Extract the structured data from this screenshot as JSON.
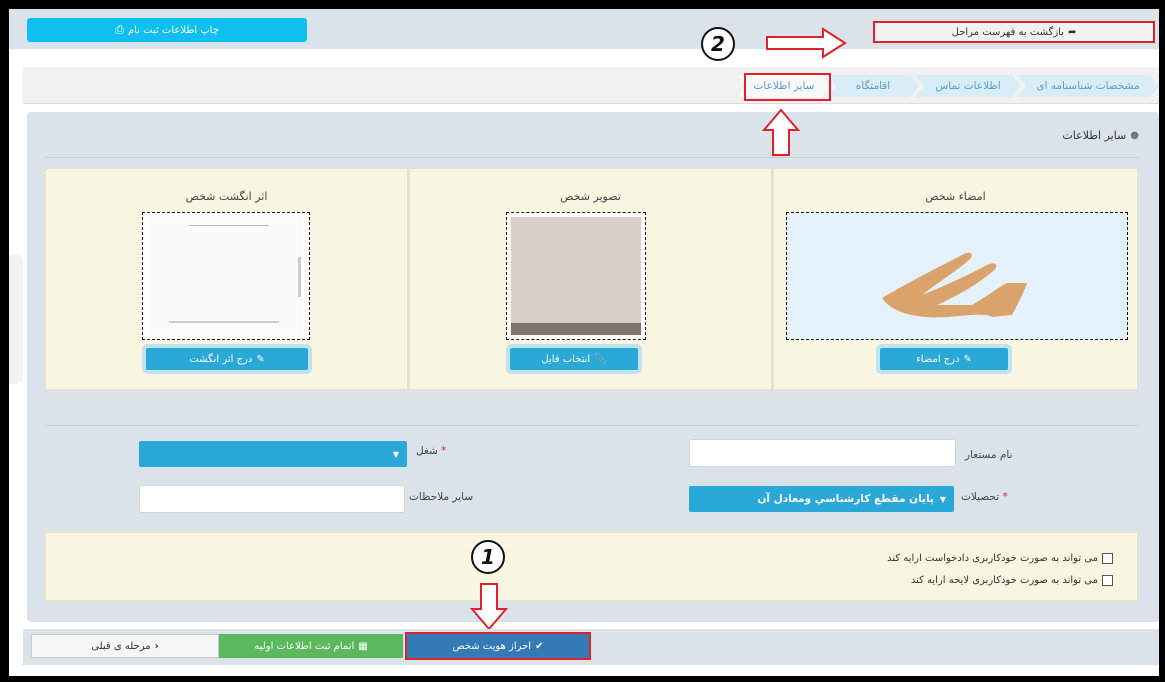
{
  "topbar": {
    "print_label": "چاپ اطلاعات ثبت نام",
    "back_label": "بازگشت به فهرست مراحل"
  },
  "breadcrumb": {
    "items": [
      "مشخصات شناسنامه ای",
      "اطلاعات تماس",
      "اقامتگاه",
      "سایر اطلاعات"
    ],
    "active_index": 3
  },
  "section": {
    "title": "سایر اطلاعات"
  },
  "cards": {
    "signature": {
      "title": "امضاء شخص",
      "button": "درج امضاء"
    },
    "photo": {
      "title": "تصویر شخص",
      "button": "انتخاب فایل"
    },
    "fingerprint": {
      "title": "اثر انگشت شخص",
      "button": "درج اثر انگشت"
    }
  },
  "form": {
    "alias_label": "نام مستعار",
    "alias_value": "",
    "job_label": "شغل",
    "job_value": "",
    "education_label": "تحصیلات",
    "education_value": "پایان مقطع کارشناسي ومعادل آن",
    "notes_label": "سایر ملاحظات",
    "notes_value": ""
  },
  "checkboxes": [
    {
      "label": "می تواند به صورت خودکاربری دادخواست ارایه کند",
      "checked": false
    },
    {
      "label": "می تواند به صورت خودکاربری لایحه ارایه کند",
      "checked": false
    }
  ],
  "footer": {
    "prev_label": "مرحله ی قبلی",
    "complete_label": "اتمام ثبت اطلاعات اولیه",
    "verify_label": "احراز هویت شخص"
  },
  "annotations": {
    "one": "1",
    "two": "2"
  },
  "colors": {
    "accent": "#2aa8d8",
    "print_button": "#0fbff0",
    "complete_button": "#5cb85c",
    "verify_button": "#337ab7",
    "highlight": "#e0202b"
  }
}
